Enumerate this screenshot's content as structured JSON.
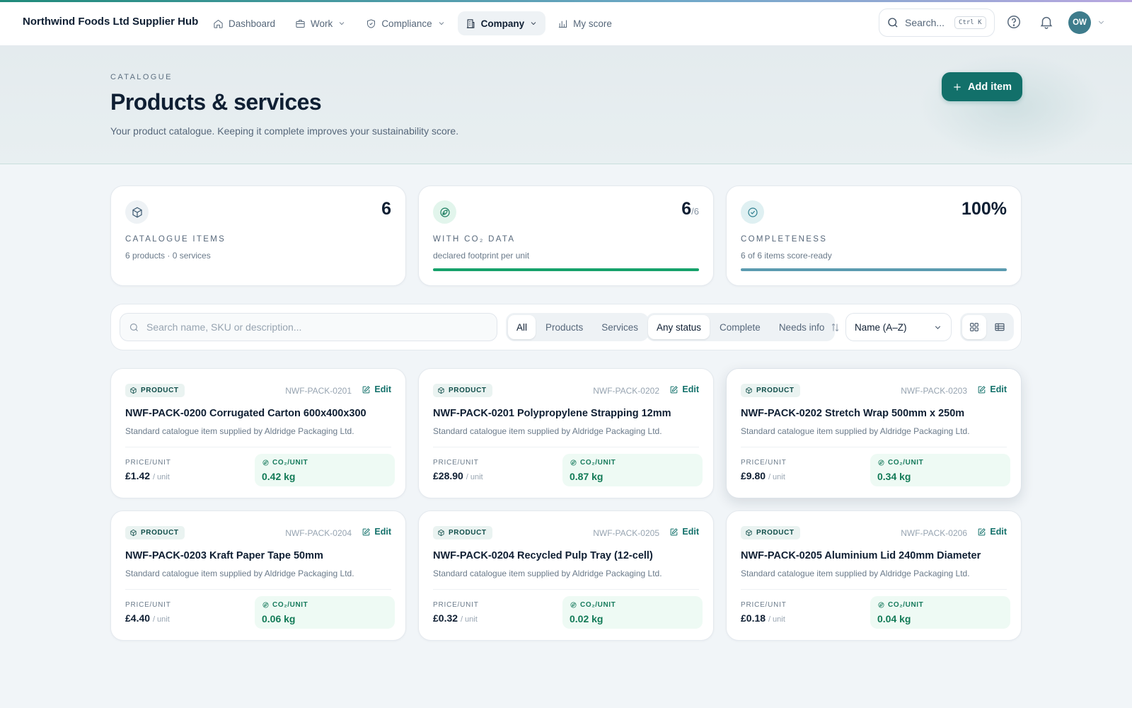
{
  "brand": "Northwind Foods Ltd Supplier Hub",
  "colors": {
    "accent": "#12706a",
    "co2_green": "#16a26b",
    "completeness_blue": "#5b9bb0"
  },
  "nav": [
    {
      "label": "Dashboard",
      "icon": "home-icon",
      "has_menu": false,
      "active": false
    },
    {
      "label": "Work",
      "icon": "briefcase-icon",
      "has_menu": true,
      "active": false
    },
    {
      "label": "Compliance",
      "icon": "shield-icon",
      "has_menu": true,
      "active": false
    },
    {
      "label": "Company",
      "icon": "building-icon",
      "has_menu": true,
      "active": true
    },
    {
      "label": "My score",
      "icon": "bar-chart-icon",
      "has_menu": false,
      "active": false
    }
  ],
  "search": {
    "label": "Search...",
    "shortcut": "Ctrl K"
  },
  "user": {
    "initials": "OW"
  },
  "hero": {
    "eyebrow": "CATALOGUE",
    "title": "Products & services",
    "subtitle": "Your product catalogue. Keeping it complete improves your sustainability score.",
    "add_button": "Add item"
  },
  "stats": [
    {
      "label": "CATALOGUE ITEMS",
      "value": "6",
      "suffix": "",
      "desc": "6 products · 0 services",
      "icon": "box-icon",
      "progress": null
    },
    {
      "label": "WITH CO₂ DATA",
      "value": "6",
      "suffix": "/6",
      "desc": "declared footprint per unit",
      "icon": "leaf-icon",
      "progress": 1.0
    },
    {
      "label": "COMPLETENESS",
      "value": "100%",
      "suffix": "",
      "desc": "6 of 6 items score-ready",
      "icon": "check-circle-icon",
      "progress": 1.0
    }
  ],
  "toolbar": {
    "search_placeholder": "Search name, SKU or description...",
    "type_filters": [
      {
        "label": "All",
        "selected": true
      },
      {
        "label": "Products",
        "selected": false
      },
      {
        "label": "Services",
        "selected": false
      }
    ],
    "status_filters": [
      {
        "label": "Any status",
        "selected": true
      },
      {
        "label": "Complete",
        "selected": false
      },
      {
        "label": "Needs info",
        "selected": false
      }
    ],
    "sort_value": "Name (A–Z)",
    "view": "grid"
  },
  "card_labels": {
    "badge": "PRODUCT",
    "edit": "Edit",
    "price": "PRICE/UNIT",
    "co2": "CO₂/UNIT",
    "per_unit": "/ unit"
  },
  "items": [
    {
      "sku": "NWF-PACK-0201",
      "name": "NWF-PACK-0200 Corrugated Carton 600x400x300",
      "desc": "Standard catalogue item supplied by Aldridge Packaging Ltd.",
      "price": "£1.42",
      "co2": "0.42 kg"
    },
    {
      "sku": "NWF-PACK-0202",
      "name": "NWF-PACK-0201 Polypropylene Strapping 12mm",
      "desc": "Standard catalogue item supplied by Aldridge Packaging Ltd.",
      "price": "£28.90",
      "co2": "0.87 kg"
    },
    {
      "sku": "NWF-PACK-0203",
      "name": "NWF-PACK-0202 Stretch Wrap 500mm x 250m",
      "desc": "Standard catalogue item supplied by Aldridge Packaging Ltd.",
      "price": "£9.80",
      "co2": "0.34 kg"
    },
    {
      "sku": "NWF-PACK-0204",
      "name": "NWF-PACK-0203 Kraft Paper Tape 50mm",
      "desc": "Standard catalogue item supplied by Aldridge Packaging Ltd.",
      "price": "£4.40",
      "co2": "0.06 kg"
    },
    {
      "sku": "NWF-PACK-0205",
      "name": "NWF-PACK-0204 Recycled Pulp Tray (12-cell)",
      "desc": "Standard catalogue item supplied by Aldridge Packaging Ltd.",
      "price": "£0.32",
      "co2": "0.02 kg"
    },
    {
      "sku": "NWF-PACK-0206",
      "name": "NWF-PACK-0205 Aluminium Lid 240mm Diameter",
      "desc": "Standard catalogue item supplied by Aldridge Packaging Ltd.",
      "price": "£0.18",
      "co2": "0.04 kg"
    }
  ]
}
